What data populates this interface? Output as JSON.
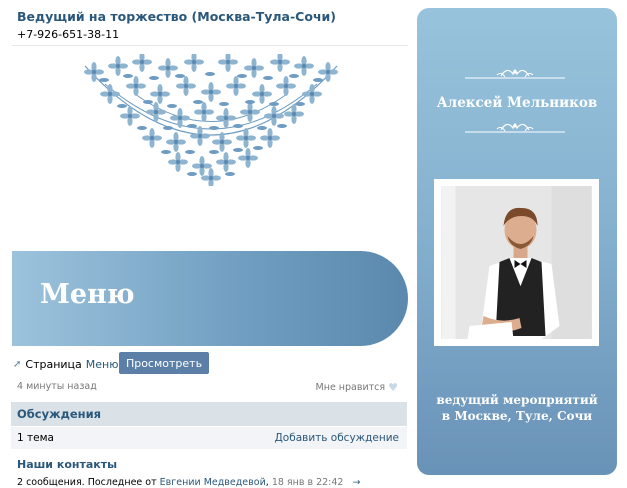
{
  "group": {
    "title": "Ведущий на торжество (Москва-Тула-Сочи)",
    "phone": "+7-926-651-38-11"
  },
  "menu_banner": {
    "label": "Меню"
  },
  "page_link": {
    "prefix": "Страница",
    "name": "Меню",
    "view_button": "Просмотреть",
    "time_ago": "4 минуты назад",
    "like_label": "Мне нравится"
  },
  "discussions": {
    "header": "Обсуждения",
    "count": "1 тема",
    "add_link": "Добавить обсуждение"
  },
  "contacts": {
    "title": "Наши контакты",
    "summary": "2 сообщения. Последнее от",
    "author": "Евгении Медведевой",
    "date": "18 янв в 22:42",
    "arrow": "→"
  },
  "card": {
    "name": "Алексей Мельников",
    "description_line1": "ведущий мероприятий",
    "description_line2": "в Москве, Туле, Сочи"
  },
  "colors": {
    "link": "#2b587a",
    "button": "#5b7fa6",
    "panel_top": "#98c3dc",
    "panel_bottom": "#6992b7"
  }
}
